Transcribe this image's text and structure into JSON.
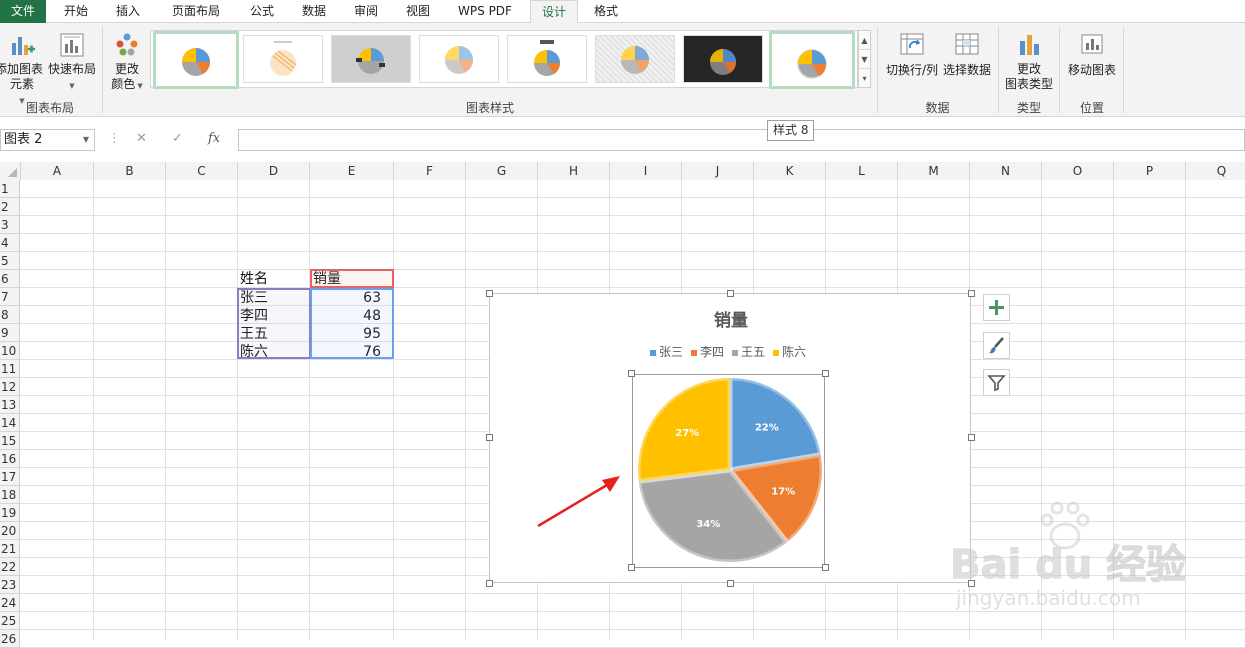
{
  "tabs": [
    "文件",
    "开始",
    "插入",
    "页面布局",
    "公式",
    "数据",
    "审阅",
    "视图",
    "WPS PDF",
    "设计",
    "格式"
  ],
  "active_tab": "设计",
  "ribbon": {
    "add_element": [
      "添加图表",
      "元素"
    ],
    "quick_layout": "快速布局",
    "group_layout": "图表布局",
    "change_color": [
      "更改",
      "颜色"
    ],
    "group_styles": "图表样式",
    "switch_row_col": "切换行/列",
    "select_data": "选择数据",
    "group_data": "数据",
    "change_type": [
      "更改",
      "图表类型"
    ],
    "group_type": "类型",
    "move_chart": "移动图表",
    "group_location": "位置"
  },
  "tooltip": "样式 8",
  "formula_bar": {
    "name_box": "图表 2",
    "fx": "fx",
    "value": ""
  },
  "columns": [
    "A",
    "B",
    "C",
    "D",
    "E",
    "F",
    "G",
    "H",
    "I",
    "J",
    "K",
    "L",
    "M",
    "N",
    "O",
    "P",
    "Q"
  ],
  "rows": [
    "1",
    "2",
    "3",
    "4",
    "5",
    "6",
    "7",
    "8",
    "9",
    "10",
    "11",
    "12",
    "13",
    "14",
    "15",
    "16",
    "17",
    "18",
    "19",
    "20",
    "21",
    "22",
    "23",
    "24",
    "25",
    "26"
  ],
  "table": {
    "header": [
      "姓名",
      "销量"
    ],
    "rows": [
      [
        "张三",
        "63"
      ],
      [
        "李四",
        "48"
      ],
      [
        "王五",
        "95"
      ],
      [
        "陈六",
        "76"
      ]
    ]
  },
  "chart_data": {
    "type": "pie",
    "title": "销量",
    "categories": [
      "张三",
      "李四",
      "王五",
      "陈六"
    ],
    "values": [
      63,
      48,
      95,
      76
    ],
    "labels": [
      "22%",
      "17%",
      "34%",
      "27%"
    ],
    "colors": [
      "#5b9bd5",
      "#ed7d31",
      "#a5a5a5",
      "#ffc000"
    ],
    "legend_position": "top"
  },
  "watermark": {
    "brand": "Bai du 经验",
    "url": "jingyan.baidu.com"
  }
}
